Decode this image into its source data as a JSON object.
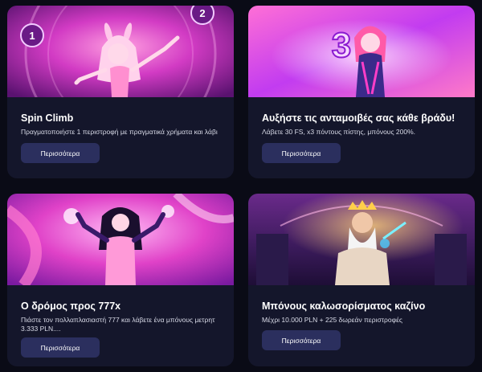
{
  "promos": [
    {
      "title": "Spin Climb",
      "description": "Πραγματοποιήστε 1 περιστροφή με πραγματικά χρήματα και λάβι",
      "button_label": "Περισσότερα",
      "banner_numbers": [
        "1",
        "2"
      ]
    },
    {
      "title": "Αυξήστε τις ανταμοιβές σας κάθε βράδυ!",
      "description": "Λάβετε 30 FS, x3 πόντους πίστης, μπόνους 200%.",
      "button_label": "Περισσότερα",
      "banner_numbers": [
        "3"
      ]
    },
    {
      "title": "Ο δρόμος προς 777x",
      "description": "Πιάστε τον πολλαπλασιαστή 777 και λάβετε ένα μπόνους μετρητ 3.333 PLN....",
      "button_label": "Περισσότερα"
    },
    {
      "title": "Μπόνους καλωσορίσματος καζίνο",
      "description": "Μέχρι 10.000 PLN + 225 δωρεάν περιστροφές",
      "button_label": "Περισσότερα"
    }
  ],
  "colors": {
    "page_background": "#0a0b16",
    "card_background": "#14162b",
    "button_background": "#2b2f5e"
  }
}
